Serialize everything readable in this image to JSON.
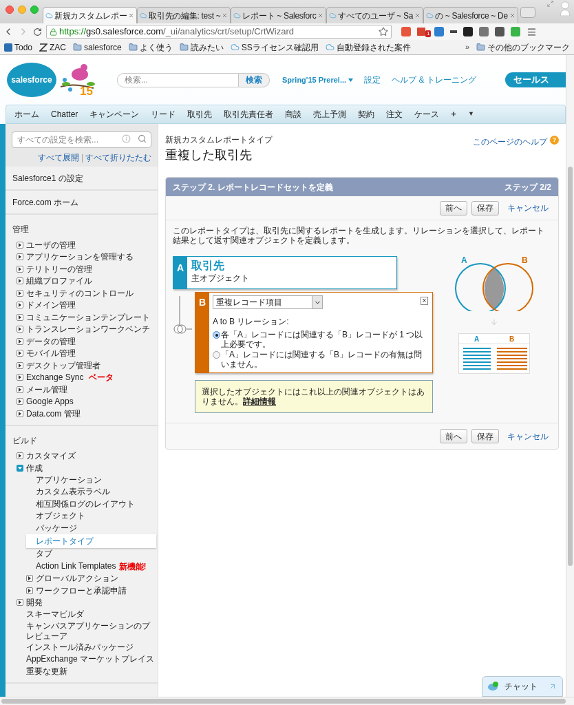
{
  "browser": {
    "tabs": [
      {
        "title": "新規カスタムレポー",
        "selected": true
      },
      {
        "title": "取引先の編集: test ~",
        "selected": false
      },
      {
        "title": "レポート ~ Salesforc",
        "selected": false
      },
      {
        "title": "すべてのユーザ ~ Sa",
        "selected": false
      },
      {
        "title": "の ~ Salesforce ~ De",
        "selected": false
      }
    ],
    "url": {
      "scheme": "https://",
      "host": "gs0.salesforce.com",
      "path": "/_ui/analytics/crt/setup/CrtWizard"
    },
    "mail_count": "1",
    "bookmarks": [
      {
        "label": "Todo",
        "kind": "board"
      },
      {
        "label": "ZAC",
        "kind": "letter"
      },
      {
        "label": "salesforce",
        "kind": "folder"
      },
      {
        "label": "よく使う",
        "kind": "folder"
      },
      {
        "label": "読みたい",
        "kind": "folder"
      },
      {
        "label": "SSライセンス確認用",
        "kind": "cloud"
      },
      {
        "label": "自動登録された案件",
        "kind": "cloud"
      }
    ],
    "bookmarks_more": "»",
    "other_bookmarks": "その他のブックマーク"
  },
  "header": {
    "logo": "salesforce",
    "anniversary": "15",
    "search_placeholder": "検索...",
    "search_button": "検索",
    "release": "Spring'15 Prerel...",
    "links": [
      "設定",
      "ヘルプ & トレーニング"
    ],
    "app_menu": "セールス"
  },
  "nav": {
    "tabs": [
      {
        "label": "ホーム",
        "selected": false
      },
      {
        "label": "Chatter",
        "selected": false
      },
      {
        "label": "キャンペーン",
        "selected": false
      },
      {
        "label": "リード",
        "selected": false
      },
      {
        "label": "取引先",
        "selected": false
      },
      {
        "label": "取引先責任者",
        "selected": false
      },
      {
        "label": "商談",
        "selected": false
      },
      {
        "label": "売上予測",
        "selected": false
      },
      {
        "label": "契約",
        "selected": false
      },
      {
        "label": "注文",
        "selected": false
      },
      {
        "label": "ケース",
        "selected": false
      }
    ],
    "add": "+",
    "more": "▼"
  },
  "sidebar": {
    "search_placeholder": "すべての設定を検索...",
    "expand_all": "すべて展開",
    "separator": "|",
    "collapse_all": "すべて折りたたむ",
    "links": [
      "Salesforce1 の設定",
      "Force.com ホーム"
    ],
    "sections": [
      {
        "title": "管理",
        "items": [
          {
            "kind": "folder",
            "label": "ユーザの管理",
            "expanded": false
          },
          {
            "kind": "folder",
            "label": "アプリケーションを管理する",
            "expanded": false
          },
          {
            "kind": "folder",
            "label": "テリトリーの管理",
            "expanded": false
          },
          {
            "kind": "folder",
            "label": "組織プロファイル",
            "expanded": false
          },
          {
            "kind": "folder",
            "label": "セキュリティのコントロール",
            "expanded": false
          },
          {
            "kind": "folder",
            "label": "ドメイン管理",
            "expanded": false
          },
          {
            "kind": "folder",
            "label": "コミュニケーションテンプレート",
            "expanded": false
          },
          {
            "kind": "folder",
            "label": "トランスレーションワークベンチ",
            "expanded": false
          },
          {
            "kind": "folder",
            "label": "データの管理",
            "expanded": false
          },
          {
            "kind": "folder",
            "label": "モバイル管理",
            "expanded": false
          },
          {
            "kind": "folder",
            "label": "デスクトップ管理者",
            "expanded": false
          },
          {
            "kind": "folder",
            "label": "Exchange Sync",
            "expanded": false,
            "badge": "ベータ"
          },
          {
            "kind": "folder",
            "label": "メール管理",
            "expanded": false
          },
          {
            "kind": "folder",
            "label": "Google Apps",
            "expanded": false
          },
          {
            "kind": "folder",
            "label": "Data.com 管理",
            "expanded": false
          }
        ]
      },
      {
        "title": "ビルド",
        "items": [
          {
            "kind": "folder",
            "label": "カスタマイズ",
            "expanded": false
          },
          {
            "kind": "folder",
            "label": "作成",
            "expanded": true,
            "children": [
              {
                "kind": "link",
                "label": "アプリケーション",
                "selected": false
              },
              {
                "kind": "link",
                "label": "カスタム表示ラベル",
                "selected": false
              },
              {
                "kind": "link",
                "label": "相互関係ログのレイアウト",
                "selected": false
              },
              {
                "kind": "link",
                "label": "オブジェクト",
                "selected": false
              },
              {
                "kind": "link",
                "label": "パッケージ",
                "selected": false
              },
              {
                "kind": "link",
                "label": "レポートタイプ",
                "selected": true
              },
              {
                "kind": "link",
                "label": "タブ",
                "selected": false
              },
              {
                "kind": "link",
                "label": "Action Link Templates",
                "selected": false,
                "badge": "新機能!"
              },
              {
                "kind": "folder",
                "label": "グローバルアクション",
                "expanded": false
              },
              {
                "kind": "folder",
                "label": "ワークフローと承認申請",
                "expanded": false
              }
            ]
          },
          {
            "kind": "folder",
            "label": "開発",
            "expanded": false
          },
          {
            "kind": "link",
            "label": "スキーマビルダ",
            "selected": false
          },
          {
            "kind": "link",
            "label": "キャンバスアプリケーションのプレビューア",
            "selected": false
          },
          {
            "kind": "link",
            "label": "インストール済みパッケージ",
            "selected": false
          },
          {
            "kind": "link",
            "label": "AppExchange マーケットプレイス",
            "selected": false
          },
          {
            "kind": "link",
            "label": "重要な更新",
            "selected": false
          }
        ]
      }
    ]
  },
  "main": {
    "subtitle": "新規カスタムレポートタイプ",
    "title": "重複した取引先",
    "help": "このページのヘルプ",
    "help_mark": "?",
    "step_title": "ステップ 2. レポートレコードセットを定義",
    "step_count": "ステップ 2/2",
    "top_buttons": [
      "前へ",
      "保存"
    ],
    "top_cancel": "キャンセル",
    "description": "このレポートタイプは、取引先に関するレポートを生成します。リレーションを選択して、レポート結果として返す関連オブジェクトを定義します。",
    "object_a": {
      "letter": "A",
      "name": "取引先",
      "caption": "主オブジェクト"
    },
    "object_b": {
      "letter": "B",
      "select": "重複レコード項目",
      "remove": "X",
      "relation_label": "A to B リレーション:",
      "options": [
        {
          "label": "各「A」レコードには関連する「B」レコードが 1 つ以上必要です。",
          "selected": true
        },
        {
          "label": "「A」レコードには関連する「B」レコードの有無は問いません。",
          "selected": false
        }
      ]
    },
    "note": {
      "text": "選択したオブジェクトにはこれ以上の関連オブジェクトはありません。",
      "link": "詳細情報"
    },
    "venn": {
      "a": "A",
      "b": "B"
    },
    "result_columns": [
      "A",
      "B"
    ],
    "bottom_buttons": [
      "前へ",
      "保存"
    ],
    "bottom_cancel": "キャンセル"
  },
  "chat": {
    "label": "チャット"
  }
}
